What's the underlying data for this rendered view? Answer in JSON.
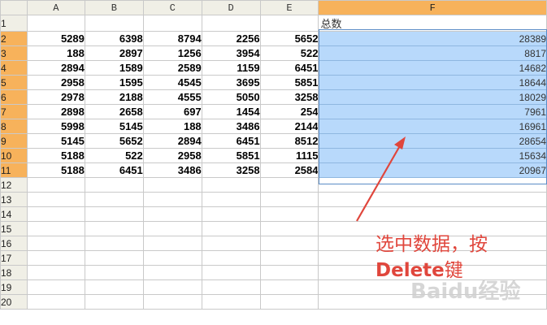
{
  "columns": [
    "A",
    "B",
    "C",
    "D",
    "E",
    "F"
  ],
  "selected_column": "F",
  "row_numbers": [
    "1",
    "2",
    "3",
    "4",
    "5",
    "6",
    "7",
    "8",
    "9",
    "10",
    "11",
    "12",
    "13",
    "14",
    "15",
    "16",
    "17",
    "18",
    "19",
    "20"
  ],
  "selected_rows": [
    "2",
    "3",
    "4",
    "5",
    "6",
    "7",
    "8",
    "9",
    "10",
    "11"
  ],
  "header_row": {
    "F": "总数"
  },
  "data_rows": [
    [
      "5289",
      "6398",
      "8794",
      "2256",
      "5652",
      "28389"
    ],
    [
      "188",
      "2897",
      "1256",
      "3954",
      "522",
      "8817"
    ],
    [
      "2894",
      "1589",
      "2589",
      "1159",
      "6451",
      "14682"
    ],
    [
      "2958",
      "1595",
      "4545",
      "3695",
      "5851",
      "18644"
    ],
    [
      "2978",
      "2188",
      "4555",
      "5050",
      "3258",
      "18029"
    ],
    [
      "2898",
      "2658",
      "697",
      "1454",
      "254",
      "7961"
    ],
    [
      "5998",
      "5145",
      "188",
      "3486",
      "2144",
      "16961"
    ],
    [
      "5145",
      "5652",
      "2894",
      "6451",
      "8512",
      "28654"
    ],
    [
      "5188",
      "522",
      "2958",
      "5851",
      "1115",
      "15634"
    ],
    [
      "5188",
      "6451",
      "3486",
      "3258",
      "2584",
      "20967"
    ]
  ],
  "annotation": {
    "line1": "选中数据，按",
    "line2_key": "Delete",
    "line2_suffix": "键"
  },
  "watermark": "Baidu经验",
  "colors": {
    "selection_fill": "#b8d9fb",
    "header_highlight": "#f7b25b",
    "annotation": "#e0463c"
  }
}
